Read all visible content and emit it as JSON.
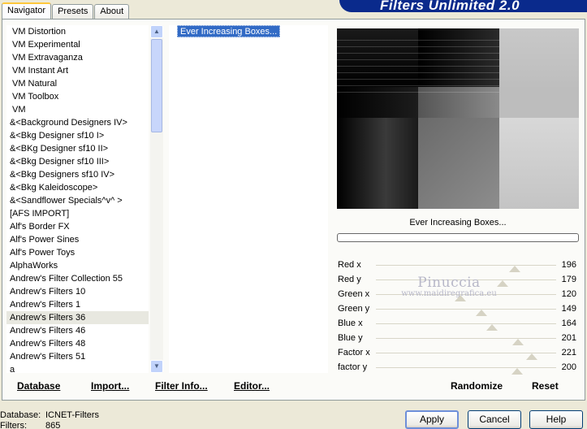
{
  "app_title": "Filters Unlimited 2.0",
  "tabs": [
    {
      "label": "Navigator",
      "active": true
    },
    {
      "label": "Presets",
      "active": false
    },
    {
      "label": "About",
      "active": false
    }
  ],
  "categories": [
    "VM Distortion",
    "VM Experimental",
    "VM Extravaganza",
    "VM Instant Art",
    "VM Natural",
    "VM Toolbox",
    "VM",
    "&<Background Designers IV>",
    "&<Bkg Designer sf10 I>",
    "&<BKg Designer sf10 II>",
    "&<Bkg Designer sf10 III>",
    "&<Bkg Designers sf10 IV>",
    "&<Bkg Kaleidoscope>",
    "&<Sandflower Specials^v^ >",
    "[AFS IMPORT]",
    "Alf's Border FX",
    "Alf's Power Sines",
    "Alf's Power Toys",
    "AlphaWorks",
    "Andrew's Filter Collection 55",
    "Andrew's Filters 10",
    "Andrew's Filters 1",
    "Andrew's Filters 36",
    "Andrew's Filters 46",
    "Andrew's Filters 48",
    "Andrew's Filters 51",
    "a"
  ],
  "selected_category": "Andrew's Filters 36",
  "effects": [
    "Ever Increasing Boxes..."
  ],
  "selected_effect": "Ever Increasing Boxes...",
  "preview_caption": "Ever Increasing Boxes...",
  "sliders": [
    {
      "label": "Red x",
      "value": 196
    },
    {
      "label": "Red y",
      "value": 179
    },
    {
      "label": "Green x",
      "value": 120
    },
    {
      "label": "Green y",
      "value": 149
    },
    {
      "label": "Blue x",
      "value": 164
    },
    {
      "label": "Blue y",
      "value": 201
    },
    {
      "label": "Factor x",
      "value": 221
    },
    {
      "label": "factor y",
      "value": 200
    }
  ],
  "slider_max": 255,
  "watermark": {
    "name": "Pinuccia",
    "url": "www.maidiregrafica.eu"
  },
  "bottom_left_buttons": {
    "database": "Database",
    "import": "Import...",
    "filter_info": "Filter Info...",
    "editor": "Editor..."
  },
  "bottom_right_buttons": {
    "randomize": "Randomize",
    "reset": "Reset"
  },
  "status": {
    "database_label": "Database:",
    "database_value": "ICNET-Filters",
    "filters_label": "Filters:",
    "filters_value": "865"
  },
  "dialog_buttons": {
    "apply": "Apply",
    "cancel": "Cancel",
    "help": "Help"
  },
  "colors": {
    "banner": "#0a2a8c",
    "selection": "#316ac5",
    "tab_highlight": "#ffc83c"
  }
}
